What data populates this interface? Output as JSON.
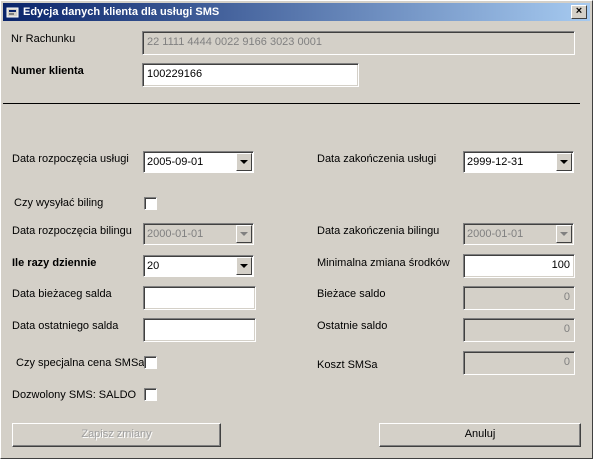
{
  "window": {
    "title": "Edycja danych klienta dla usługi SMS",
    "close_label": "×"
  },
  "account": {
    "label": "Nr Rachunku",
    "value": "22 1111 4444 0022 9166 3023 0001"
  },
  "client": {
    "label": "Numer klienta",
    "value": "100229166"
  },
  "service": {
    "start_label": "Data rozpoczęcia usługi",
    "start_value": "2005-09-01",
    "end_label": "Data zakończenia usługi",
    "end_value": "2999-12-31"
  },
  "billing": {
    "send_label": "Czy wysyłać biling",
    "send_checked": false,
    "start_label": "Data rozpoczęcia bilingu",
    "start_value": "2000-01-01",
    "end_label": "Data zakończenia bilingu",
    "end_value": "2000-01-01"
  },
  "daily": {
    "label": "Ile razy dziennie",
    "value": "20"
  },
  "min_change": {
    "label": "Minimalna zmiana środków",
    "value": "100"
  },
  "current_balance_date": {
    "label": "Data bieżaceg salda",
    "value": ""
  },
  "current_balance": {
    "label": "Bieżace saldo",
    "value": "0"
  },
  "last_balance_date": {
    "label": "Data ostatniego salda",
    "value": ""
  },
  "last_balance": {
    "label": "Ostatnie saldo",
    "value": "0"
  },
  "special_price": {
    "label": "Czy specjalna cena SMSa",
    "checked": false
  },
  "sms_cost": {
    "label": "Koszt SMSa",
    "value": "0"
  },
  "allowed_saldo": {
    "label": "Dozwolony SMS: SALDO",
    "checked": false
  },
  "buttons": {
    "save": "Zapisz zmiany",
    "cancel": "Anuluj"
  }
}
